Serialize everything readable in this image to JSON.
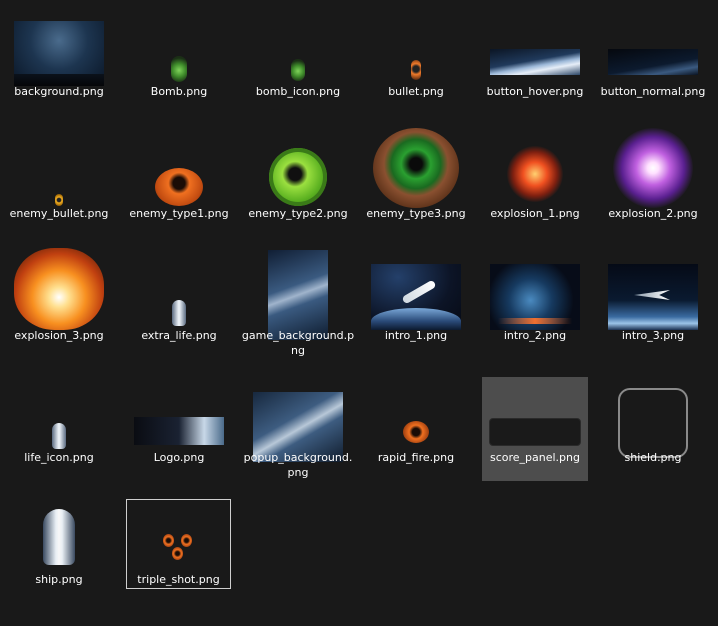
{
  "files": [
    {
      "name": "background.png",
      "icon": "space-landscape-thumbnail"
    },
    {
      "name": "Bomb.png",
      "icon": "green-bomb-thumbnail"
    },
    {
      "name": "bomb_icon.png",
      "icon": "green-bomb-thumbnail"
    },
    {
      "name": "bullet.png",
      "icon": "orange-bullet-thumbnail"
    },
    {
      "name": "button_hover.png",
      "icon": "earth-horizon-thumbnail"
    },
    {
      "name": "button_normal.png",
      "icon": "dark-horizon-thumbnail"
    },
    {
      "name": "enemy_bullet.png",
      "icon": "yellow-bullet-thumbnail"
    },
    {
      "name": "enemy_type1.png",
      "icon": "orange-donut-thumbnail"
    },
    {
      "name": "enemy_type2.png",
      "icon": "green-spiky-thumbnail"
    },
    {
      "name": "enemy_type3.png",
      "icon": "green-donut-thumbnail"
    },
    {
      "name": "explosion_1.png",
      "icon": "red-explosion-thumbnail"
    },
    {
      "name": "explosion_2.png",
      "icon": "purple-explosion-thumbnail"
    },
    {
      "name": "explosion_3.png",
      "icon": "orange-explosion-thumbnail"
    },
    {
      "name": "extra_life.png",
      "icon": "small-ship-thumbnail"
    },
    {
      "name": "game_background.png",
      "icon": "nebula-thumbnail"
    },
    {
      "name": "intro_1.png",
      "icon": "spaceship-earth-thumbnail"
    },
    {
      "name": "intro_2.png",
      "icon": "spaceship-planet-thumbnail"
    },
    {
      "name": "intro_3.png",
      "icon": "jet-earth-thumbnail"
    },
    {
      "name": "life_icon.png",
      "icon": "small-ship-thumbnail"
    },
    {
      "name": "Logo.png",
      "icon": "logo-banner-thumbnail"
    },
    {
      "name": "popup_background.png",
      "icon": "nebula-thumbnail"
    },
    {
      "name": "rapid_fire.png",
      "icon": "orange-orb-thumbnail"
    },
    {
      "name": "score_panel.png",
      "icon": "dark-panel-thumbnail"
    },
    {
      "name": "shield.png",
      "icon": "rounded-frame-thumbnail"
    },
    {
      "name": "ship.png",
      "icon": "white-ship-thumbnail"
    },
    {
      "name": "triple_shot.png",
      "icon": "three-orbs-thumbnail"
    }
  ],
  "state": {
    "hovered": "score_panel.png",
    "selected": "triple_shot.png"
  }
}
